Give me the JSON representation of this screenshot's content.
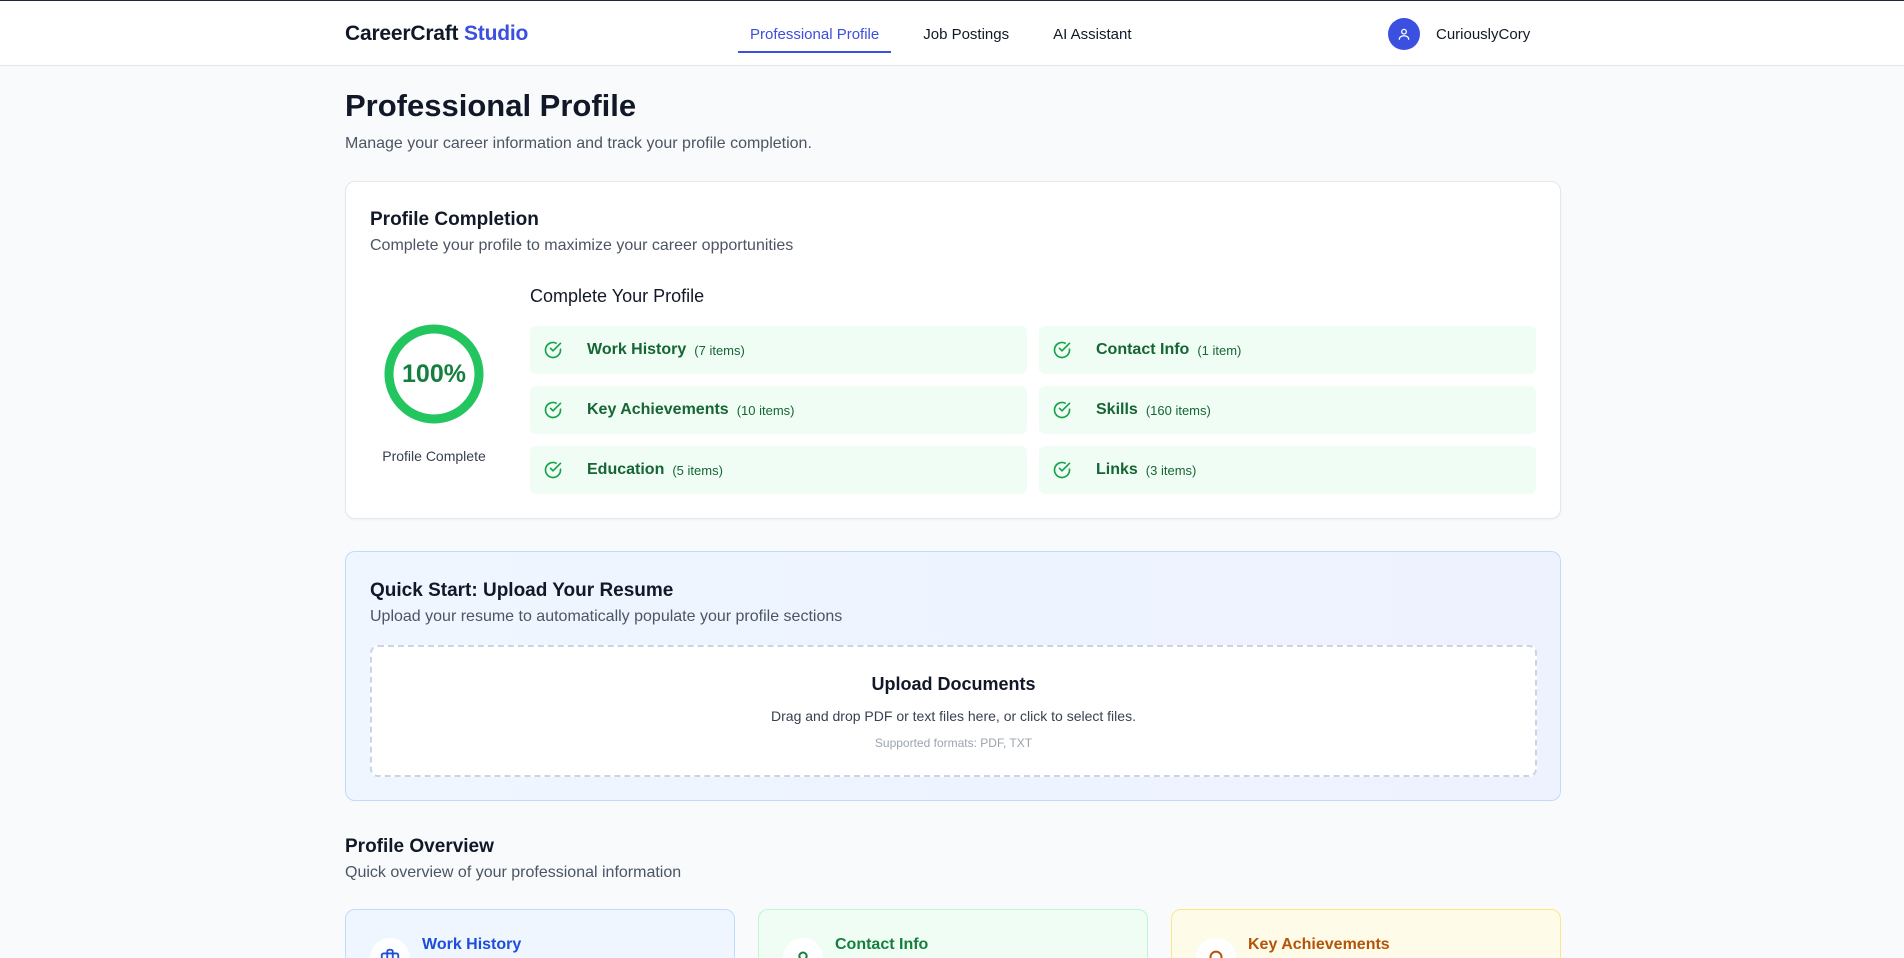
{
  "header": {
    "brand_main": "CareerCraft",
    "brand_accent": "Studio",
    "nav": [
      {
        "label": "Professional Profile",
        "active": true
      },
      {
        "label": "Job Postings",
        "active": false
      },
      {
        "label": "AI Assistant",
        "active": false
      }
    ],
    "user_name": "CuriouslyCory",
    "user_icon": "user-icon"
  },
  "page": {
    "title": "Professional Profile",
    "subtitle": "Manage your career information and track your profile completion."
  },
  "completion": {
    "title": "Profile Completion",
    "subtitle": "Complete your profile to maximize your career opportunities",
    "percent_text": "100%",
    "percent_value": 100,
    "percent_label": "Profile Complete",
    "checklist_title": "Complete Your Profile",
    "items": [
      {
        "label": "Work History",
        "count": "(7 items)",
        "done": true
      },
      {
        "label": "Contact Info",
        "count": "(1 item)",
        "done": true
      },
      {
        "label": "Key Achievements",
        "count": "(10 items)",
        "done": true
      },
      {
        "label": "Skills",
        "count": "(160 items)",
        "done": true
      },
      {
        "label": "Education",
        "count": "(5 items)",
        "done": true
      },
      {
        "label": "Links",
        "count": "(3 items)",
        "done": true
      }
    ],
    "color": "#22c55e"
  },
  "upload": {
    "title": "Quick Start: Upload Your Resume",
    "subtitle": "Upload your resume to automatically populate your profile sections",
    "drop_title": "Upload Documents",
    "drop_text": "Drag and drop PDF or text files here, or click to select files.",
    "drop_formats": "Supported formats: PDF, TXT"
  },
  "overview": {
    "title": "Profile Overview",
    "subtitle": "Quick overview of your professional information",
    "cards": [
      {
        "label": "Work History",
        "icon": "briefcase-icon",
        "color": "#1d4ed8"
      },
      {
        "label": "Contact Info",
        "icon": "user-icon",
        "color": "#15803d"
      },
      {
        "label": "Key Achievements",
        "icon": "trophy-icon",
        "color": "#b45309"
      }
    ]
  }
}
